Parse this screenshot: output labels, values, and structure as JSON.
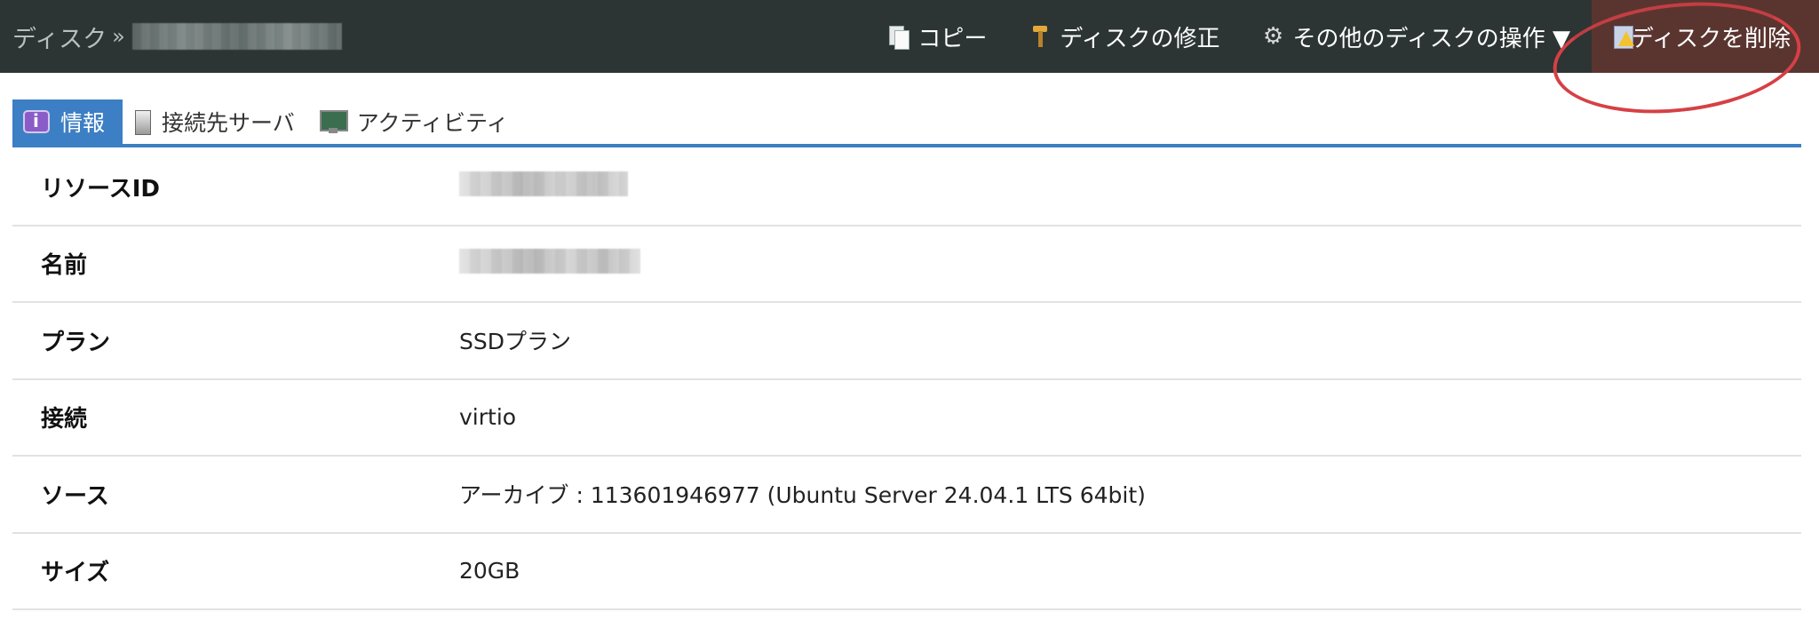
{
  "header": {
    "breadcrumb_root": "ディスク",
    "breadcrumb_sep": "»",
    "actions": {
      "copy": "コピー",
      "fix": "ディスクの修正",
      "more": "その他のディスクの操作 ▼",
      "delete": "ディスクを削除"
    },
    "icons": {
      "copy": "copy-icon",
      "fix": "wrench-icon",
      "more": "gear-icon",
      "delete": "warning-document-icon"
    },
    "delete_highlight_color": "#5a3530",
    "annotation_color": "#d64045"
  },
  "tabs": [
    {
      "label": "情報",
      "icon": "info-icon",
      "active": true
    },
    {
      "label": "接続先サーバ",
      "icon": "server-icon",
      "active": false
    },
    {
      "label": "アクティビティ",
      "icon": "monitor-icon",
      "active": false
    }
  ],
  "tab_accent_color": "#3d7fc4",
  "details": {
    "resource_id": {
      "label": "リソースID"
    },
    "name": {
      "label": "名前"
    },
    "plan": {
      "label": "プラン",
      "value": "SSDプラン"
    },
    "connection": {
      "label": "接続",
      "value": "virtio"
    },
    "source": {
      "label": "ソース",
      "value": "アーカイブ : 113601946977 (Ubuntu Server 24.04.1 LTS 64bit)"
    },
    "size": {
      "label": "サイズ",
      "value": "20GB"
    }
  }
}
